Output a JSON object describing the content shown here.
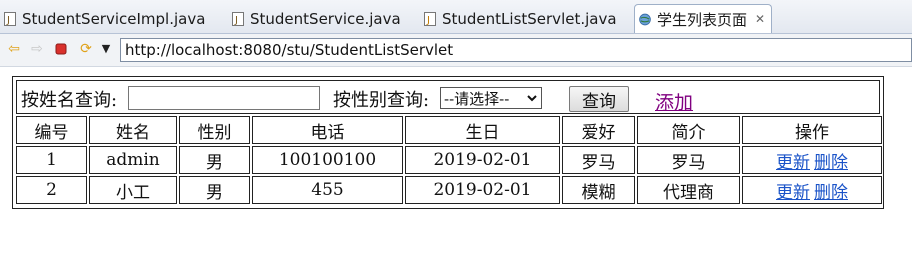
{
  "tabs": [
    {
      "label": "StudentServiceImpl.java",
      "icon": "java-file-icon",
      "active": false
    },
    {
      "label": "StudentService.java",
      "icon": "java-file-icon",
      "active": false
    },
    {
      "label": "StudentListServlet.java",
      "icon": "java-file-icon",
      "active": false
    },
    {
      "label": "学生列表页面",
      "icon": "globe-icon",
      "active": true
    }
  ],
  "nav": {
    "url": "http://localhost:8080/stu/StudentListServlet"
  },
  "search": {
    "name_label": "按姓名查询:",
    "name_value": "",
    "gender_label": "按性别查询:",
    "gender_selected": "--请选择--",
    "query_button": "查询",
    "add_link": "添加"
  },
  "table": {
    "headers": [
      "编号",
      "姓名",
      "性别",
      "电话",
      "生日",
      "爱好",
      "简介",
      "操作"
    ],
    "rows": [
      {
        "id": "1",
        "name": "admin",
        "gender": "男",
        "phone": "100100100",
        "birthday": "2019-02-01",
        "hobby": "罗马",
        "intro": "罗马"
      },
      {
        "id": "2",
        "name": "小工",
        "gender": "男",
        "phone": "455",
        "birthday": "2019-02-01",
        "hobby": "模糊",
        "intro": "代理商"
      }
    ],
    "update_label": "更新",
    "delete_label": "删除"
  },
  "colors": {
    "add_link": "#800080",
    "action_link": "#1a53c8"
  }
}
